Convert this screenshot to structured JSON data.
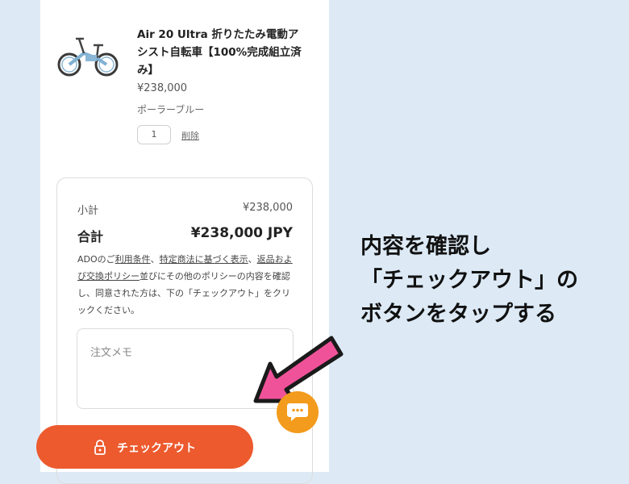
{
  "product": {
    "title": "Air 20 Ultra 折りたたみ電動アシスト自転車【100%完成組立済み】",
    "price": "¥238,000",
    "variant": "ポーラーブルー",
    "quantity": "1",
    "remove_label": "削除"
  },
  "summary": {
    "subtotal_label": "小計",
    "subtotal_value": "¥238,000",
    "total_label": "合計",
    "total_value": "¥238,000 JPY",
    "policy": {
      "t1": "ADOのご",
      "l1": "利用条件",
      "t2": "、",
      "l2": "特定商法に基づく表示",
      "t3": "、",
      "l3": "返品および交換ポリシー",
      "t4": "並びにその他のポリシーの内容を確認し、同意された方は、下の「チェックアウト」をクリックください。"
    },
    "memo_placeholder": "注文メモ"
  },
  "checkout": {
    "label": "チェックアウト",
    "icon": "lock-icon"
  },
  "chat": {
    "icon": "chat-icon"
  },
  "annotation": {
    "line1": "内容を確認し",
    "line2": "「チェックアウト」の",
    "line3": "ボタンをタップする"
  },
  "colors": {
    "accent": "#ec5a2e",
    "chat": "#f39b1c",
    "arrow": "#f0529a",
    "background": "#ddeaf6"
  }
}
